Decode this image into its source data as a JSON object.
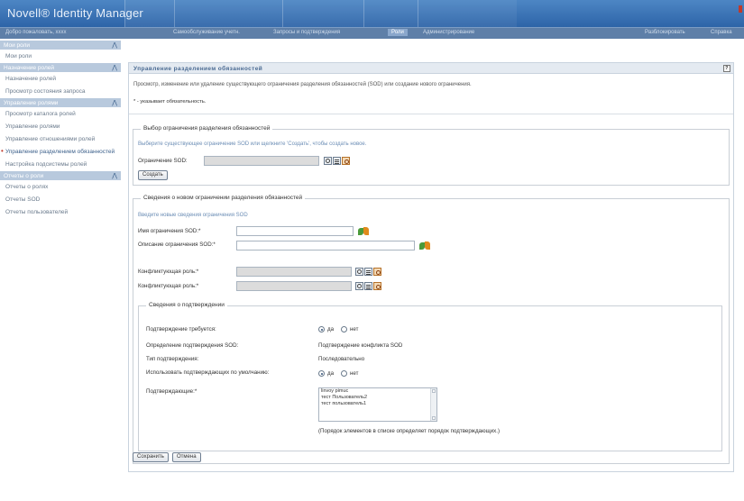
{
  "app": {
    "logo": "Novell® Identity Manager",
    "welcome": "Добро пожаловать, xxxx"
  },
  "nav": {
    "items": [
      {
        "label": "Самообслуживание учетн.",
        "active": false
      },
      {
        "label": "Запросы и подтверждения",
        "active": false
      },
      {
        "label": "Роли",
        "active": true
      },
      {
        "label": "Администрирование",
        "active": false
      }
    ],
    "right": [
      "Разблокировать",
      "Справка"
    ]
  },
  "sidebar": {
    "sections": [
      {
        "title": "Мои роли",
        "items": [
          "Мои роли"
        ]
      },
      {
        "title": "Назначение ролей",
        "items": [
          "Назначение ролей",
          "Просмотр состояния запроса"
        ]
      },
      {
        "title": "Управление ролями",
        "items": [
          "Просмотр каталога ролей",
          "Управление ролями",
          "Управление отношениями ролей",
          "Управление разделением обязанностей",
          "Настройка подсистемы ролей"
        ]
      },
      {
        "title": "Отчеты о роли",
        "items": [
          "Отчеты о ролях",
          "Отчеты SOD",
          "Отчеты пользователей"
        ]
      }
    ],
    "current_item": "Управление разделением обязанностей"
  },
  "panel": {
    "title": "Управление разделением обязанностей",
    "help": "?",
    "intro": "Просмотр, изменение или удаление существующего ограничения разделения обязанностей (SOD) или создание нового ограничения.",
    "required_note": "* - указывает обязательность."
  },
  "select_section": {
    "legend": "Выбор ограничения разделения обязанностей",
    "hint": "Выберите существующее ограничение SOD или щелкните 'Создать', чтобы создать новое.",
    "constraint_label": "Ограничение SOD:",
    "constraint_value": "",
    "create_button": "Создать"
  },
  "new_section": {
    "legend": "Сведения о новом ограничении разделения обязанностей",
    "hint": "Введите новые сведения ограничения SOD",
    "name_label": "Имя ограничения SOD:*",
    "name_value": "",
    "desc_label": "Описание ограничения SOD:*",
    "desc_value": "",
    "role1_label": "Конфликтующая роль:*",
    "role1_value": "",
    "role2_label": "Конфликтующая роль:*",
    "role2_value": ""
  },
  "approval": {
    "legend": "Сведения о подтверждении",
    "required_label": "Подтверждение требуется:",
    "yes": "да",
    "no": "нет",
    "required_value": "да",
    "definition_label": "Определение подтверждения SOD:",
    "definition_value": "Подтверждение конфликта SOD",
    "type_label": "Тип подтверждения:",
    "type_value": "Последовательно",
    "default_label": "Использовать подтверждающих по умолчанию:",
    "default_value": "да",
    "approvers_label": "Подтверждающие:*",
    "approvers": [
      "linvoy pimuc",
      "тест Пользователь2",
      "тест пользователь1"
    ],
    "order_note": "(Порядок элементов в списке определяет порядок подтверждающих.)"
  },
  "actions": {
    "save": "Сохранить",
    "cancel": "Отмена"
  }
}
